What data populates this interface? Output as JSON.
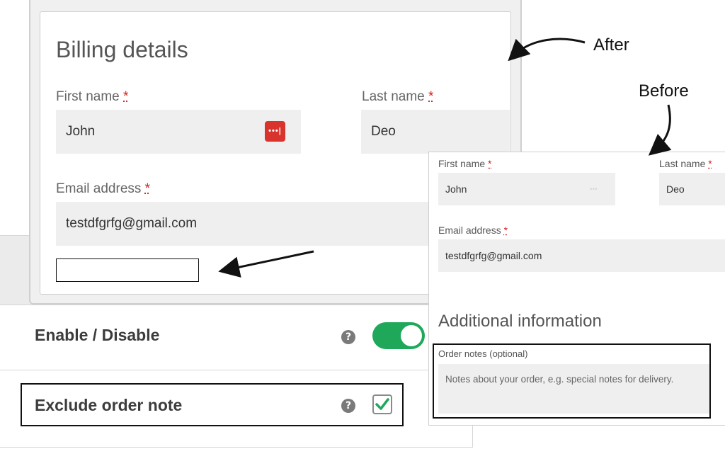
{
  "settings": {
    "enable_disable_label": "Enable / Disable",
    "exclude_order_note_label": "Exclude order note",
    "help_glyph": "?",
    "toggle_on": true,
    "checkbox_checked": true,
    "accent_color": "#1fa85a",
    "checkmark_color": "#1fa85a"
  },
  "after": {
    "title": "Billing details",
    "first_name_label": "First name",
    "last_name_label": "Last name",
    "email_label": "Email address",
    "required_marker": "*",
    "first_name_value": "John",
    "last_name_value": "Deo",
    "email_value": "testdfgrfg@gmail.com",
    "password_icon_text": "•••|",
    "password_icon_color": "#d9332d"
  },
  "before": {
    "first_name_label": "First name",
    "last_name_label": "Last name",
    "email_label": "Email address",
    "required_marker": "*",
    "first_name_value": "John",
    "last_name_value": "Deo",
    "email_value": "testdfgrfg@gmail.com",
    "password_dots": "•••",
    "additional_heading": "Additional information",
    "order_notes_label": "Order notes (optional)",
    "order_notes_placeholder": "Notes about your order, e.g. special notes for delivery."
  },
  "annotations": {
    "after_label": "After",
    "before_label": "Before"
  }
}
